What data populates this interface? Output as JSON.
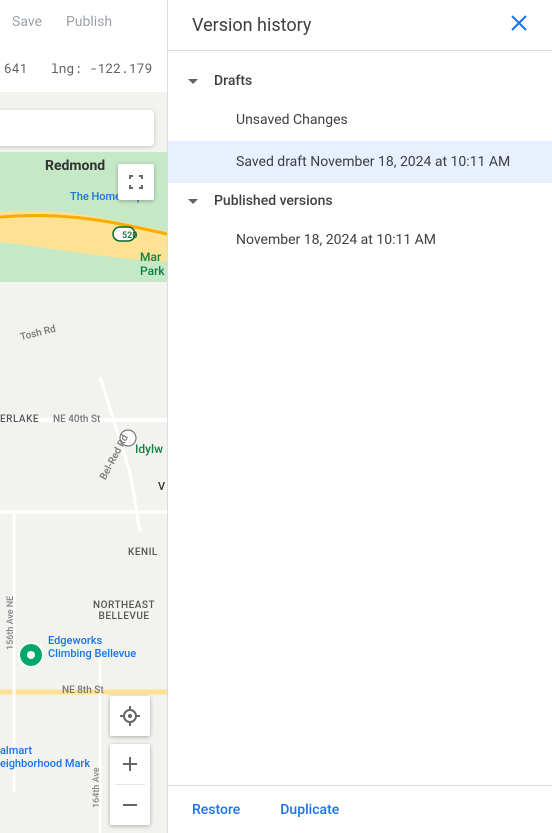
{
  "toolbar": {
    "save": "Save",
    "publish": "Publish"
  },
  "coords": {
    "lat_val": "641",
    "lng_label": "lng:",
    "lng_val": "-122.179"
  },
  "map": {
    "redmond": "Redmond",
    "home_depot": "The Home Dep",
    "marymoor": "Mar\nPark",
    "tosh": "Tosh Rd",
    "erlake": "ERLAKE",
    "ne40": "NE 40th St",
    "belred": "Bel-Red Rd",
    "idylw": "Idylw",
    "vi": "V",
    "kenil": "KENIL",
    "nebellevue": "NORTHEAST\nBELLEVUE",
    "edgeworks": "Edgeworks\nClimbing Bellevue",
    "ne8": "NE 8th St",
    "walmart": "almart\neighborhood Mark",
    "ave156": "156th Ave NE",
    "ave164": "164th Ave",
    "sr520": "520"
  },
  "panel": {
    "title": "Version history",
    "sections": {
      "drafts": "Drafts",
      "published": "Published versions"
    },
    "versions": {
      "unsaved": "Unsaved Changes",
      "saved_draft": "Saved draft November 18, 2024 at 10:11 AM",
      "published_item": "November 18, 2024 at 10:11 AM"
    },
    "footer": {
      "restore": "Restore",
      "duplicate": "Duplicate"
    }
  }
}
